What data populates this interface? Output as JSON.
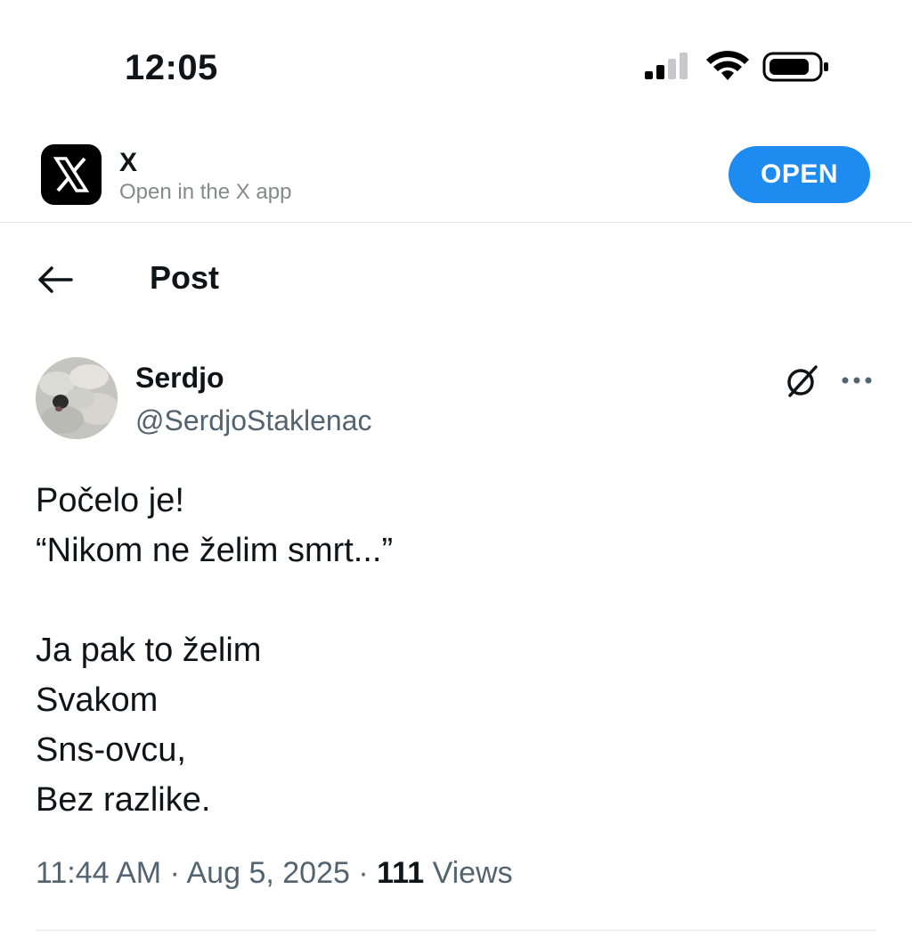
{
  "status_bar": {
    "time": "12:05",
    "icons": [
      "cellular-signal-icon",
      "wifi-icon",
      "battery-icon"
    ]
  },
  "app_banner": {
    "app_name": "X",
    "subtitle": "Open in the X app",
    "open_label": "OPEN",
    "accent_color": "#1d8bf0"
  },
  "header": {
    "title": "Post",
    "back_icon": "arrow-left-icon"
  },
  "post": {
    "author": {
      "name": "Serdjo",
      "handle": "@SerdjoStaklenac"
    },
    "lines": [
      "Počelo je!",
      "“Nikom ne želim smrt...”",
      "",
      "Ja pak to želim",
      "Svakom",
      "Sns-ovcu,",
      "Bez razlike."
    ],
    "time": "11:44 AM",
    "date": "Aug 5, 2025",
    "separator": "·",
    "views_count": "111",
    "views_label": "Views"
  }
}
